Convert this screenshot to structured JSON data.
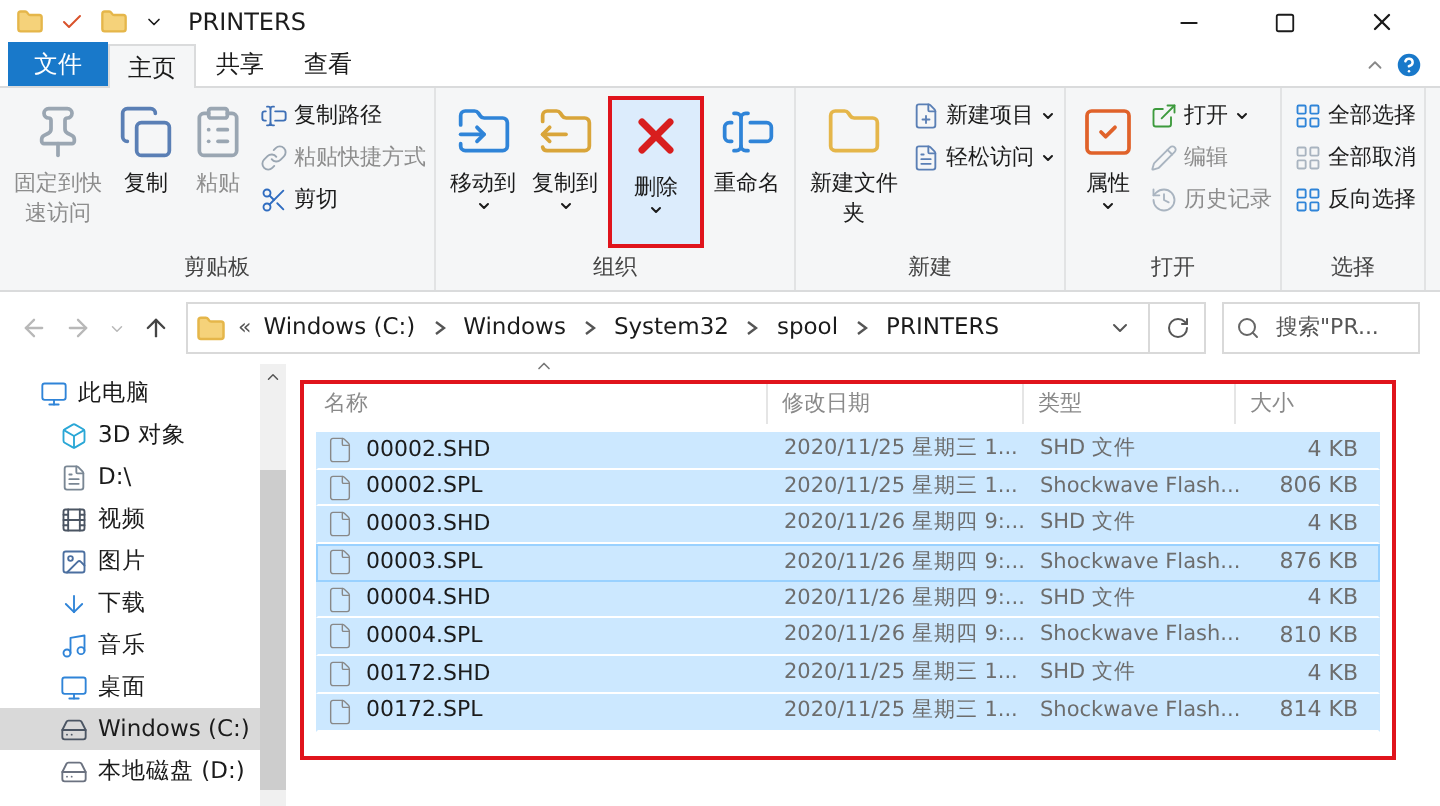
{
  "window": {
    "title": "PRINTERS"
  },
  "tabs": [
    {
      "label": "文件",
      "kind": "file",
      "selected": false
    },
    {
      "label": "主页",
      "kind": "tab",
      "selected": true
    },
    {
      "label": "共享",
      "kind": "tab",
      "selected": false
    },
    {
      "label": "查看",
      "kind": "tab",
      "selected": false
    }
  ],
  "ribbon": {
    "groups": [
      {
        "label": "剪贴板",
        "large": [
          {
            "label": "固定到快速访问",
            "disabled": true
          },
          {
            "label": "复制",
            "disabled": false
          },
          {
            "label": "粘贴",
            "disabled": true
          }
        ],
        "small": [
          {
            "label": "复制路径",
            "disabled": false,
            "dropdown": false
          },
          {
            "label": "粘贴快捷方式",
            "disabled": true,
            "dropdown": false
          },
          {
            "label": "剪切",
            "disabled": false,
            "dropdown": false
          }
        ]
      },
      {
        "label": "组织",
        "large": [
          {
            "label": "移动到",
            "disabled": false,
            "dropdown": true,
            "highlighted": false
          },
          {
            "label": "复制到",
            "disabled": false,
            "dropdown": true,
            "highlighted": false
          },
          {
            "label": "删除",
            "disabled": false,
            "dropdown": true,
            "highlighted": true
          },
          {
            "label": "重命名",
            "disabled": false,
            "dropdown": false,
            "highlighted": false
          }
        ]
      },
      {
        "label": "新建",
        "large": [
          {
            "label": "新建文件夹",
            "disabled": false
          }
        ],
        "small": [
          {
            "label": "新建项目",
            "disabled": false,
            "dropdown": true
          },
          {
            "label": "轻松访问",
            "disabled": false,
            "dropdown": true
          }
        ]
      },
      {
        "label": "打开",
        "large": [
          {
            "label": "属性",
            "disabled": false,
            "dropdown": true
          }
        ],
        "small": [
          {
            "label": "打开",
            "disabled": false,
            "dropdown": true
          },
          {
            "label": "编辑",
            "disabled": true,
            "dropdown": false
          },
          {
            "label": "历史记录",
            "disabled": true,
            "dropdown": false
          }
        ]
      },
      {
        "label": "选择",
        "small": [
          {
            "label": "全部选择",
            "disabled": false,
            "dropdown": false
          },
          {
            "label": "全部取消",
            "disabled": false,
            "dropdown": false
          },
          {
            "label": "反向选择",
            "disabled": false,
            "dropdown": false
          }
        ]
      }
    ]
  },
  "address": {
    "overflow": "«",
    "crumbs": [
      "Windows (C:)",
      "Windows",
      "System32",
      "spool",
      "PRINTERS"
    ]
  },
  "search": {
    "placeholder": "搜索\"PR..."
  },
  "sidebar": {
    "items": [
      {
        "label": "此电脑",
        "selected": false,
        "children": [
          {
            "label": "3D 对象",
            "selected": false
          },
          {
            "label": "D:\\",
            "selected": false
          },
          {
            "label": "视频",
            "selected": false
          },
          {
            "label": "图片",
            "selected": false
          },
          {
            "label": "下载",
            "selected": false
          },
          {
            "label": "音乐",
            "selected": false
          },
          {
            "label": "桌面",
            "selected": false
          },
          {
            "label": "Windows (C:)",
            "selected": true
          },
          {
            "label": "本地磁盘 (D:)",
            "selected": false
          }
        ]
      }
    ]
  },
  "table": {
    "columns": [
      "名称",
      "修改日期",
      "类型",
      "大小"
    ],
    "rows": [
      {
        "name": "00002.SHD",
        "date": "2020/11/25 星期三 1...",
        "type": "SHD 文件",
        "size": "4 KB",
        "selected": true,
        "focused": false
      },
      {
        "name": "00002.SPL",
        "date": "2020/11/25 星期三 1...",
        "type": "Shockwave Flash...",
        "size": "806 KB",
        "selected": true,
        "focused": false
      },
      {
        "name": "00003.SHD",
        "date": "2020/11/26 星期四 9:...",
        "type": "SHD 文件",
        "size": "4 KB",
        "selected": true,
        "focused": false
      },
      {
        "name": "00003.SPL",
        "date": "2020/11/26 星期四 9:...",
        "type": "Shockwave Flash...",
        "size": "876 KB",
        "selected": true,
        "focused": true
      },
      {
        "name": "00004.SHD",
        "date": "2020/11/26 星期四 9:...",
        "type": "SHD 文件",
        "size": "4 KB",
        "selected": true,
        "focused": false
      },
      {
        "name": "00004.SPL",
        "date": "2020/11/26 星期四 9:...",
        "type": "Shockwave Flash...",
        "size": "810 KB",
        "selected": true,
        "focused": false
      },
      {
        "name": "00172.SHD",
        "date": "2020/11/25 星期三 1...",
        "type": "SHD 文件",
        "size": "4 KB",
        "selected": true,
        "focused": false
      },
      {
        "name": "00172.SPL",
        "date": "2020/11/25 星期三 1...",
        "type": "Shockwave Flash...",
        "size": "814 KB",
        "selected": true,
        "focused": false
      }
    ]
  }
}
